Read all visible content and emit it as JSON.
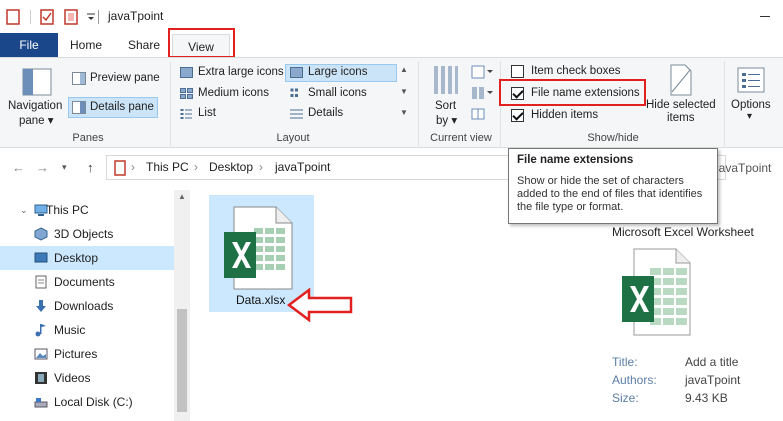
{
  "window": {
    "title": "javaTpoint"
  },
  "tabs": [
    {
      "label": "File"
    },
    {
      "label": "Home"
    },
    {
      "label": "Share"
    },
    {
      "label": "View"
    }
  ],
  "ribbon": {
    "panes": {
      "group_label": "Panes",
      "navigation_pane_line1": "Navigation",
      "navigation_pane_line2": "pane ▾",
      "preview_pane": "Preview pane",
      "details_pane": "Details pane"
    },
    "layout": {
      "group_label": "Layout",
      "options": [
        "Extra large icons",
        "Large icons",
        "Medium icons",
        "Small icons",
        "List",
        "Details"
      ],
      "selected": "Large icons"
    },
    "current_view": {
      "group_label": "Current view",
      "sort_line1": "Sort",
      "sort_line2": "by ▾"
    },
    "show_hide": {
      "group_label": "Show/hide",
      "item_check_boxes": "Item check boxes",
      "item_check_boxes_checked": false,
      "file_name_extensions": "File name extensions",
      "file_name_extensions_checked": true,
      "hidden_items": "Hidden items",
      "hidden_items_checked": true,
      "hide_selected_line1": "Hide selected",
      "hide_selected_line2": "items"
    },
    "options": {
      "label": "Options",
      "caret": "▾"
    }
  },
  "address_bar": {
    "crumbs": [
      "This PC",
      "Desktop",
      "javaTpoint"
    ],
    "search_fragment": "h javaTpoint"
  },
  "sidebar": {
    "items": [
      {
        "label": "This PC",
        "icon": "computer-icon"
      },
      {
        "label": "3D Objects",
        "icon": "cube-icon"
      },
      {
        "label": "Desktop",
        "icon": "desktop-icon",
        "selected": true
      },
      {
        "label": "Documents",
        "icon": "documents-icon"
      },
      {
        "label": "Downloads",
        "icon": "download-icon"
      },
      {
        "label": "Music",
        "icon": "music-icon"
      },
      {
        "label": "Pictures",
        "icon": "pictures-icon"
      },
      {
        "label": "Videos",
        "icon": "videos-icon"
      },
      {
        "label": "Local Disk (C:)",
        "icon": "drive-icon"
      }
    ]
  },
  "files": [
    {
      "name": "Data.xlsx",
      "icon": "excel-file-icon",
      "selected": true
    }
  ],
  "tooltip": {
    "title": "File name extensions",
    "body": "Show or hide the set of characters added to the end of files that identifies the file type or format."
  },
  "preview": {
    "file_type": "Microsoft Excel Worksheet",
    "meta": [
      {
        "key": "Title:",
        "value": "Add a title"
      },
      {
        "key": "Authors:",
        "value": "javaTpoint"
      },
      {
        "key": "Size:",
        "value": "9.43 KB"
      }
    ]
  },
  "colors": {
    "file_tab": "#19478a",
    "selection": "#cce8ff",
    "highlight_box": "#e32020",
    "excel_green": "#1e7145"
  }
}
